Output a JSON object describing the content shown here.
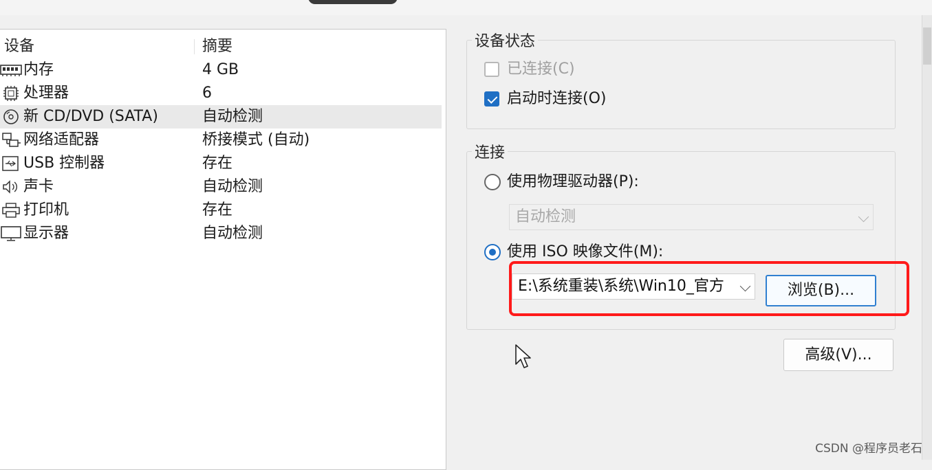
{
  "devices": {
    "header": {
      "device": "设备",
      "summary": "摘要"
    },
    "rows": [
      {
        "icon": "memory-icon",
        "name": "内存",
        "summary": "4 GB"
      },
      {
        "icon": "processor-icon",
        "name": "处理器",
        "summary": "6"
      },
      {
        "icon": "cd-dvd-icon",
        "name": "新 CD/DVD (SATA)",
        "summary": "自动检测",
        "selected": true
      },
      {
        "icon": "network-adapter-icon",
        "name": "网络适配器",
        "summary": "桥接模式 (自动)"
      },
      {
        "icon": "usb-icon",
        "name": "USB 控制器",
        "summary": "存在"
      },
      {
        "icon": "sound-card-icon",
        "name": "声卡",
        "summary": "自动检测"
      },
      {
        "icon": "printer-icon",
        "name": "打印机",
        "summary": "存在"
      },
      {
        "icon": "display-icon",
        "name": "显示器",
        "summary": "自动检测"
      }
    ]
  },
  "device_status": {
    "title": "设备状态",
    "connected": {
      "label": "已连接(C)",
      "checked": false,
      "disabled": true
    },
    "connect_at_power_on": {
      "label": "启动时连接(O)",
      "checked": true
    }
  },
  "connection": {
    "title": "连接",
    "physical_drive": {
      "label": "使用物理驱动器(P):",
      "selected": false
    },
    "physical_select": {
      "value": "自动检测",
      "disabled": true
    },
    "iso": {
      "label": "使用 ISO 映像文件(M):",
      "selected": true
    },
    "iso_path": "E:\\系统重装\\系统\\Win10_官方",
    "browse_label": "浏览(B)...",
    "advanced_label": "高级(V)..."
  },
  "colors": {
    "accent": "#1f6fc4",
    "highlight": "#ff1a1a"
  },
  "watermark": "CSDN @程序员老石"
}
